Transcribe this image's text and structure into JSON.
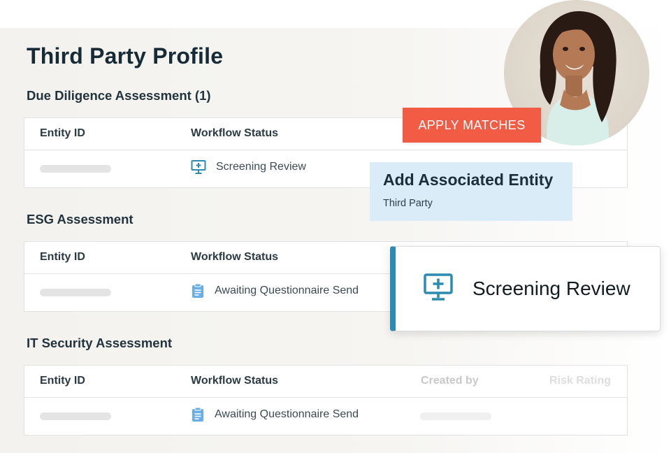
{
  "page": {
    "title": "Third Party Profile"
  },
  "actions": {
    "apply_matches": "APPLY MATCHES"
  },
  "associated_entity": {
    "title": "Add Associated Entity",
    "subtitle": "Third Party"
  },
  "status_callout": {
    "label": "Screening Review",
    "icon": "monitor-plus-icon"
  },
  "colors": {
    "accent_orange": "#f25c45",
    "accent_blue": "#2b8bb0",
    "card_blue": "#d9ecf7"
  },
  "sections": [
    {
      "title": "Due Diligence Assessment (1)",
      "columns": [
        "Entity ID",
        "Workflow Status"
      ],
      "rows": [
        {
          "workflow_status": "Screening Review",
          "icon": "monitor-plus-icon"
        }
      ]
    },
    {
      "title": "ESG Assessment",
      "columns": [
        "Entity ID",
        "Workflow Status"
      ],
      "rows": [
        {
          "workflow_status": "Awaiting Questionnaire Send",
          "icon": "clipboard-icon"
        }
      ]
    },
    {
      "title": "IT Security Assessment",
      "columns": [
        "Entity ID",
        "Workflow Status",
        "Created by",
        "Risk Rating"
      ],
      "rows": [
        {
          "workflow_status": "Awaiting Questionnaire Send",
          "icon": "clipboard-icon"
        }
      ]
    }
  ]
}
